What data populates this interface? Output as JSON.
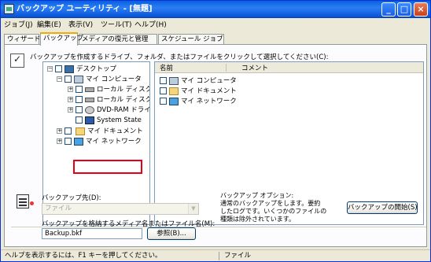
{
  "window": {
    "title": "バックアップ ユーティリティ - [無題]"
  },
  "titlebar_buttons": {
    "minimize": "_",
    "maximize": "□",
    "close": "×"
  },
  "menu": [
    "ジョブ(J)",
    "編集(E)",
    "表示(V)",
    "ツール(T)",
    "ヘルプ(H)"
  ],
  "tabs": [
    "ウィザード",
    "バックアップ",
    "メディアの復元と管理",
    "スケジュール ジョブ"
  ],
  "active_tab": "バックアップ",
  "instruction": "バックアップを作成するドライブ、フォルダ、またはファイルをクリックして選択してください(C):",
  "tree": {
    "items": [
      {
        "label": "デスクトップ",
        "expander": "−",
        "icon": "desktop-icon"
      },
      {
        "label": "マイ コンピュータ",
        "expander": "−",
        "icon": "computer-icon"
      },
      {
        "label": "ローカル ディスク (",
        "expander": "+",
        "icon": "disk-icon"
      },
      {
        "label": "ローカル ディスク (",
        "expander": "+",
        "icon": "disk-icon"
      },
      {
        "label": "DVD-RAM ドライ",
        "expander": "+",
        "icon": "dvd-drive-icon"
      },
      {
        "label": "System State",
        "expander": "",
        "icon": "system-state-icon"
      },
      {
        "label": "マイ ドキュメント",
        "expander": "+",
        "icon": "folder-icon"
      },
      {
        "label": "マイ ネットワーク",
        "expander": "+",
        "icon": "network-icon"
      }
    ],
    "highlighted": "マイ ドキュメント"
  },
  "list": {
    "columns": [
      "名前",
      "コメント"
    ],
    "rows": [
      {
        "name": "マイ コンピュータ",
        "icon": "computer-icon"
      },
      {
        "name": "マイ ドキュメント",
        "icon": "folder-icon"
      },
      {
        "name": "マイ ネットワーク",
        "icon": "network-icon"
      }
    ]
  },
  "destination": {
    "label": "バックアップ先(D):",
    "value": "ファイル",
    "media_label": "バックアップを格納するメディア名またはファイル名(M):",
    "filename": "Backup.bkf",
    "browse_button": "参照(B)..."
  },
  "options": {
    "title": "バックアップ オプション:",
    "lines": [
      "通常のバックアップをします。要約",
      "したログです。いくつかのファイルの",
      "種類は除外されています。"
    ]
  },
  "start_button": "バックアップの開始(S)",
  "status": {
    "help": "ヘルプを表示するには、F1 キーを押してください。",
    "type": "ファイル"
  },
  "colors": {
    "highlight": "#e60012",
    "titlebar": "#0a5fe0",
    "tab_accent": "#f6a800"
  }
}
